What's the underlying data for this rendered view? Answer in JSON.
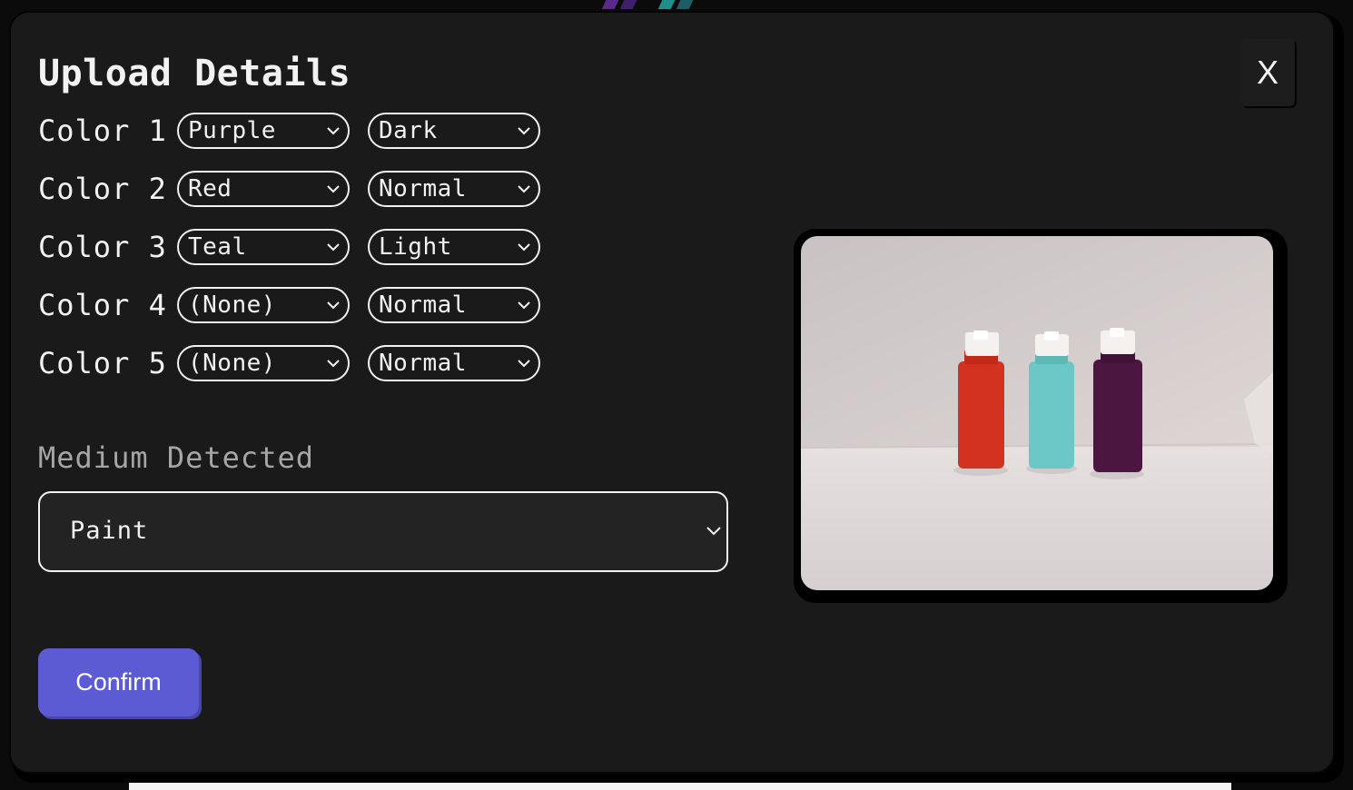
{
  "dialog": {
    "title": "Upload Details",
    "close_label": "X"
  },
  "colors": [
    {
      "label": "Color 1",
      "hue": "Purple",
      "shade": "Dark"
    },
    {
      "label": "Color 2",
      "hue": "Red",
      "shade": "Normal"
    },
    {
      "label": "Color 3",
      "hue": "Teal",
      "shade": "Light"
    },
    {
      "label": "Color 4",
      "hue": "(None)",
      "shade": "Normal"
    },
    {
      "label": "Color 5",
      "hue": "(None)",
      "shade": "Normal"
    }
  ],
  "medium": {
    "label": "Medium Detected",
    "value": "Paint"
  },
  "confirm_label": "Confirm",
  "icons": {
    "dropdown": "chevron-down-icon",
    "close": "close-icon"
  },
  "theme": {
    "background": "#1a1a1a",
    "text": "#f2f2f2",
    "muted_text": "#a6a6a6",
    "accent": "#5d5bd4"
  },
  "photo": {
    "bottles": [
      "red",
      "teal",
      "purple"
    ]
  }
}
